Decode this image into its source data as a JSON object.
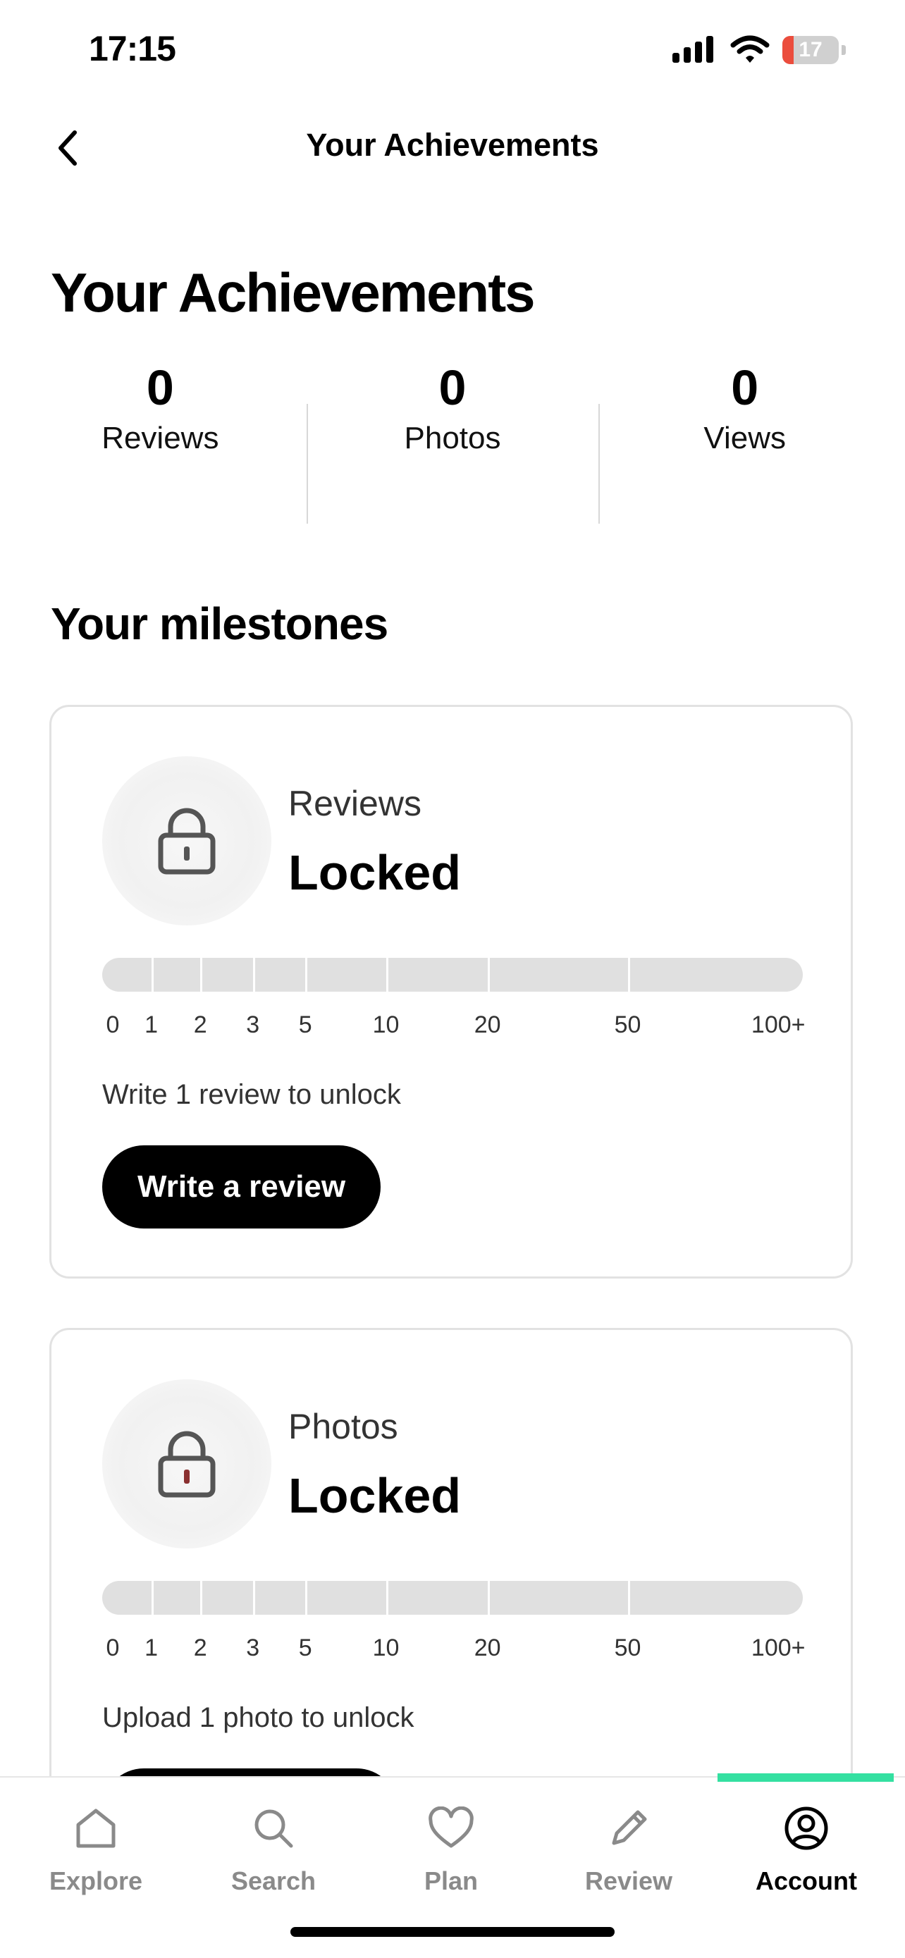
{
  "status_bar": {
    "time": "17:15",
    "battery": "17"
  },
  "header": {
    "title": "Your Achievements"
  },
  "page_title": "Your Achievements",
  "stats": [
    {
      "value": "0",
      "label": "Reviews"
    },
    {
      "value": "0",
      "label": "Photos"
    },
    {
      "value": "0",
      "label": "Views"
    }
  ],
  "milestones_title": "Your milestones",
  "milestones": [
    {
      "kind": "Reviews",
      "status": "Locked",
      "progress": 0,
      "ticks": [
        "0",
        "1",
        "2",
        "3",
        "5",
        "10",
        "20",
        "50",
        "100+"
      ],
      "unlock_text": "Write 1 review to unlock",
      "button_label": "Write a review"
    },
    {
      "kind": "Photos",
      "status": "Locked",
      "progress": 0,
      "ticks": [
        "0",
        "1",
        "2",
        "3",
        "5",
        "10",
        "20",
        "50",
        "100+"
      ],
      "unlock_text": "Upload 1 photo to unlock",
      "button_label": ""
    }
  ],
  "tab_bar": {
    "items": [
      {
        "label": "Explore",
        "icon": "home-icon",
        "active": false
      },
      {
        "label": "Search",
        "icon": "search-icon",
        "active": false
      },
      {
        "label": "Plan",
        "icon": "heart-icon",
        "active": false
      },
      {
        "label": "Review",
        "icon": "pencil-icon",
        "active": false
      },
      {
        "label": "Account",
        "icon": "account-icon",
        "active": true
      }
    ],
    "active_color": "#34e0a1"
  }
}
